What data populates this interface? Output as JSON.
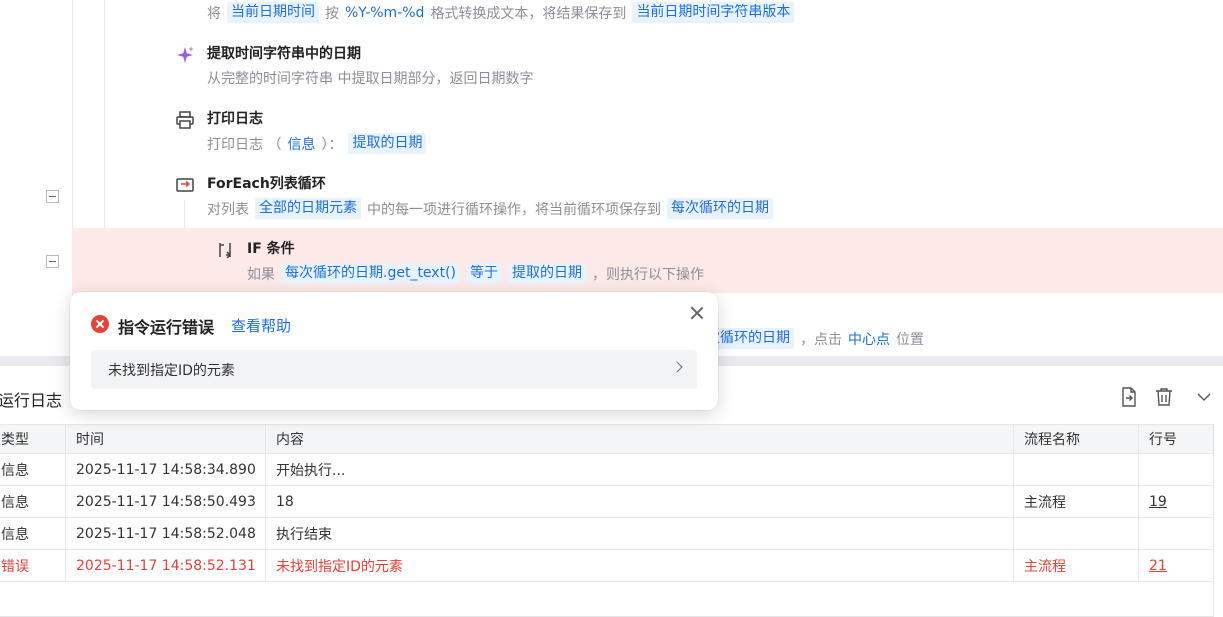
{
  "steps": {
    "format_date": {
      "desc_prefix": "将",
      "var_in": "当前日期时间",
      "by": "按",
      "format": "%Y-%m-%d",
      "desc_mid": "格式转换成文本，将结果保存到",
      "var_out": "当前日期时间字符串版本"
    },
    "extract_date": {
      "title": "提取时间字符串中的日期",
      "desc": "从完整的时间字符串  中提取日期部分，返回日期数字"
    },
    "print_log": {
      "title": "打印日志",
      "desc_prefix": "打印日志 （",
      "level": "信息",
      "desc_mid": "）：",
      "var": "提取的日期"
    },
    "foreach": {
      "title": "ForEach列表循环",
      "desc_prefix": "对列表",
      "list_var": "全部的日期元素",
      "desc_mid": "中的每一项进行循环操作，将当前循环项保存到",
      "item_var": "每次循环的日期"
    },
    "if_cond": {
      "title": "IF 条件",
      "desc_prefix": "如果",
      "left": "每次循环的日期.get_text()",
      "op": "等于",
      "right": "提取的日期",
      "desc_suffix": "，则执行以下操作"
    },
    "click": {
      "var": "次循环的日期",
      "desc_mid": "，点击",
      "point": "中心点",
      "desc_suffix": "位置"
    }
  },
  "popover": {
    "title": "指令运行错误",
    "help_link": "查看帮助",
    "error_item": "未找到指定ID的元素"
  },
  "log": {
    "title": "运行日志",
    "columns": {
      "type": "类型",
      "time": "时间",
      "content": "内容",
      "flow": "流程名称",
      "line": "行号"
    },
    "rows": [
      {
        "type": "信息",
        "time": "2025-11-17 14:58:34.890",
        "content": "开始执行...",
        "flow": "",
        "line": ""
      },
      {
        "type": "信息",
        "time": "2025-11-17 14:58:50.493",
        "content": "18",
        "flow": "主流程",
        "line": "19"
      },
      {
        "type": "信息",
        "time": "2025-11-17 14:58:52.048",
        "content": "执行结束",
        "flow": "",
        "line": ""
      },
      {
        "type": "错误",
        "time": "2025-11-17 14:58:52.131",
        "content": "未找到指定ID的元素",
        "flow": "主流程",
        "line": "21"
      }
    ]
  },
  "icons": {
    "extract": "sparkle-icon",
    "print": "printer-icon",
    "loop": "loop-icon",
    "if": "branch-icon",
    "export": "export-icon",
    "delete": "trash-icon",
    "collapse": "chevron-down-icon",
    "error": "error-circle-icon",
    "close": "close-icon",
    "chevron": "chevron-right-icon"
  },
  "colors": {
    "accent": "#1e6fd9",
    "error": "#e0443a",
    "chip_bg": "#e8f3ff",
    "error_row_bg": "#fde9e7"
  }
}
